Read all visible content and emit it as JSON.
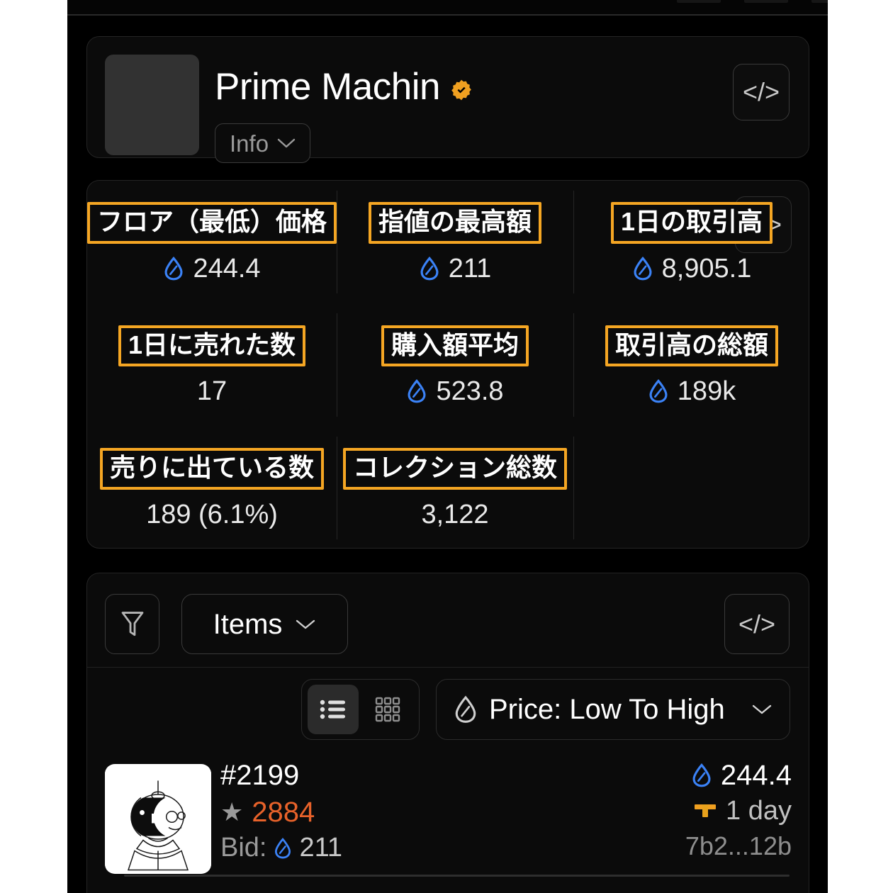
{
  "header": {
    "collection_name": "Prime Machin",
    "verified_badge": "verified-badge",
    "info_label": "Info",
    "code_glyph": "</>"
  },
  "stats": {
    "code_glyph": "</>",
    "items": [
      {
        "label": "フロア（最低）価格",
        "value": "244.4",
        "has_sol": true
      },
      {
        "label": "指値の最高額",
        "value": "211",
        "has_sol": true
      },
      {
        "label": "1日の取引高",
        "value": "8,905.1",
        "has_sol": true
      },
      {
        "label": "1日に売れた数",
        "value": "17",
        "has_sol": false
      },
      {
        "label": "購入額平均",
        "value": "523.8",
        "has_sol": true
      },
      {
        "label": "取引高の総額",
        "value": "189k",
        "has_sol": true
      },
      {
        "label": "売りに出ている数",
        "value": "189 (6.1%)",
        "has_sol": false
      },
      {
        "label": "コレクション総数",
        "value": "3,122",
        "has_sol": false
      }
    ]
  },
  "items_panel": {
    "filter_icon": "funnel-icon",
    "tab_label": "Items",
    "code_glyph": "</>",
    "view_list_icon": "list-view-icon",
    "view_grid_icon": "grid-view-icon",
    "sort_label": "Price: Low To High",
    "rows": [
      {
        "id": "#2199",
        "rank": "2884",
        "bid_label": "Bid:",
        "bid_value": "211",
        "price": "244.4",
        "time": "1 day",
        "address": "7b2...12b"
      }
    ]
  },
  "colors": {
    "accent_orange": "#f5a623",
    "sol_blue": "#3b82f6",
    "rank_orange": "#e8622a",
    "verified_orange": "#f0a020",
    "background": "#000000"
  }
}
